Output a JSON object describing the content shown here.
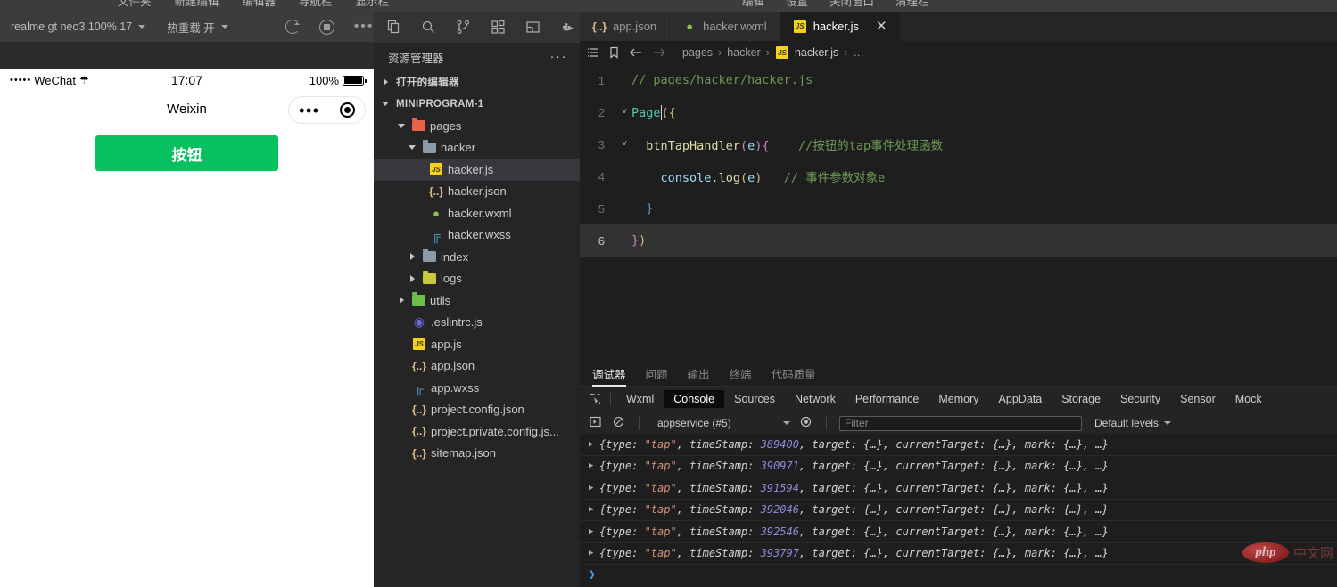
{
  "menubar": {
    "left_items": [
      "文件夹",
      "新建编辑",
      "编辑器",
      "导航栏",
      "显示栏"
    ],
    "right_items": [
      "编辑",
      "设置",
      "关闭窗口",
      "清理栏"
    ]
  },
  "simulator": {
    "device_selector": "realme gt neo3 100% 17",
    "hot_reload_label": "热重载 开",
    "icons": [
      "refresh-icon",
      "stop-icon",
      "more-icon"
    ],
    "phone": {
      "status_carrier": "WeChat",
      "status_dots": "•••••",
      "wifi_icon": "wifi-icon",
      "time": "17:07",
      "battery_percent": "100%",
      "nav_title": "Weixin",
      "capsule_more": "•••",
      "capsule_target": "target-icon",
      "button_label": "按钮",
      "button_color": "#07c160"
    }
  },
  "sidebar": {
    "activity_icons": [
      "files-icon",
      "search-icon",
      "source-control-icon",
      "extensions-icon",
      "layout-icon",
      "docker-icon"
    ],
    "title": "资源管理器",
    "more": "···",
    "sections": [
      {
        "label": "打开的编辑器",
        "expanded": false
      },
      {
        "label": "MINIPROGRAM-1",
        "expanded": true
      }
    ],
    "tree": [
      {
        "label": "pages",
        "type": "folder",
        "icon": "folder-pages-icon",
        "depth": 1,
        "expanded": true,
        "selected": false
      },
      {
        "label": "hacker",
        "type": "folder",
        "icon": "folder-icon",
        "depth": 2,
        "expanded": true,
        "selected": false
      },
      {
        "label": "hacker.js",
        "type": "js",
        "icon": "js-file-icon",
        "depth": 3,
        "selected": true
      },
      {
        "label": "hacker.json",
        "type": "json",
        "icon": "json-file-icon",
        "depth": 3,
        "selected": false
      },
      {
        "label": "hacker.wxml",
        "type": "wxml",
        "icon": "wxml-file-icon",
        "depth": 3,
        "selected": false
      },
      {
        "label": "hacker.wxss",
        "type": "wxss",
        "icon": "wxss-file-icon",
        "depth": 3,
        "selected": false
      },
      {
        "label": "index",
        "type": "folder",
        "icon": "folder-icon",
        "depth": 2,
        "expanded": false,
        "selected": false
      },
      {
        "label": "logs",
        "type": "folder",
        "icon": "folder-logs-icon",
        "depth": 2,
        "expanded": false,
        "selected": false
      },
      {
        "label": "utils",
        "type": "folder",
        "icon": "folder-utils-icon",
        "depth": 1,
        "expanded": false,
        "selected": false
      },
      {
        "label": ".eslintrc.js",
        "type": "eslint",
        "icon": "eslint-file-icon",
        "depth": 2,
        "selected": false
      },
      {
        "label": "app.js",
        "type": "js",
        "icon": "js-file-icon",
        "depth": 2,
        "selected": false
      },
      {
        "label": "app.json",
        "type": "json",
        "icon": "json-file-icon",
        "depth": 2,
        "selected": false
      },
      {
        "label": "app.wxss",
        "type": "wxss",
        "icon": "wxss-file-icon",
        "depth": 2,
        "selected": false
      },
      {
        "label": "project.config.json",
        "type": "json",
        "icon": "json-file-icon",
        "depth": 2,
        "selected": false
      },
      {
        "label": "project.private.config.js...",
        "type": "json",
        "icon": "json-file-icon",
        "depth": 2,
        "selected": false
      },
      {
        "label": "sitemap.json",
        "type": "json",
        "icon": "json-file-icon",
        "depth": 2,
        "selected": false
      }
    ]
  },
  "editor": {
    "tabs": [
      {
        "label": "app.json",
        "icon": "json-file-icon",
        "active": false,
        "closable": false
      },
      {
        "label": "hacker.wxml",
        "icon": "wxml-file-icon",
        "active": false,
        "closable": false
      },
      {
        "label": "hacker.js",
        "icon": "js-file-icon",
        "active": true,
        "closable": true
      }
    ],
    "close_icon": "✕",
    "breadcrumb_icons": [
      "outline-icon",
      "bookmark-icon",
      "back-arrow-icon",
      "forward-arrow-icon"
    ],
    "breadcrumb": [
      "pages",
      "hacker",
      "hacker.js",
      "…"
    ],
    "lines": [
      {
        "num": "1",
        "fold": "",
        "active": false
      },
      {
        "num": "2",
        "fold": "chevron-down",
        "active": false
      },
      {
        "num": "3",
        "fold": "chevron-down",
        "active": false
      },
      {
        "num": "4",
        "fold": "",
        "active": false
      },
      {
        "num": "5",
        "fold": "",
        "active": false
      },
      {
        "num": "6",
        "fold": "",
        "active": true
      }
    ],
    "code": {
      "l1_comment": "// pages/hacker/hacker.js",
      "l2_page": "Page",
      "l2_paren": "({",
      "l3_fn": "btnTapHandler",
      "l3_open": "(",
      "l3_arg": "e",
      "l3_close": "){",
      "l3_comment": "//按钮的tap事件处理函数",
      "l4_console": "console",
      "l4_dot": ".",
      "l4_log": "log",
      "l4_open": "(",
      "l4_arg": "e",
      "l4_close": ")",
      "l4_comment": "// 事件参数对象e",
      "l5_brace": "}",
      "l6_brace": "}",
      "l6_paren": ")"
    }
  },
  "panel": {
    "tabs": [
      {
        "label": "调试器",
        "active": true
      },
      {
        "label": "问题",
        "active": false
      },
      {
        "label": "输出",
        "active": false
      },
      {
        "label": "终端",
        "active": false
      },
      {
        "label": "代码质量",
        "active": false
      }
    ],
    "devtools_tabs": [
      {
        "label": "Wxml",
        "active": false
      },
      {
        "label": "Console",
        "active": true
      },
      {
        "label": "Sources",
        "active": false
      },
      {
        "label": "Network",
        "active": false
      },
      {
        "label": "Performance",
        "active": false
      },
      {
        "label": "Memory",
        "active": false
      },
      {
        "label": "AppData",
        "active": false
      },
      {
        "label": "Storage",
        "active": false
      },
      {
        "label": "Security",
        "active": false
      },
      {
        "label": "Sensor",
        "active": false
      },
      {
        "label": "Mock",
        "active": false
      }
    ],
    "inspect_icon": "inspect-element-icon",
    "console_toolbar": {
      "execute_icon": "execute-icon",
      "clear_icon": "clear-console-icon",
      "context": "appservice (#5)",
      "eye_icon": "live-expression-icon",
      "filter_placeholder": "Filter",
      "filter_value": "",
      "levels": "Default levels"
    },
    "console_logs": [
      {
        "prefix": "{type: ",
        "str": "\"tap\"",
        "mid": ", timeStamp: ",
        "num": "389400",
        "suffix": ", target: {…}, currentTarget: {…}, mark: {…}, …}"
      },
      {
        "prefix": "{type: ",
        "str": "\"tap\"",
        "mid": ", timeStamp: ",
        "num": "390971",
        "suffix": ", target: {…}, currentTarget: {…}, mark: {…}, …}"
      },
      {
        "prefix": "{type: ",
        "str": "\"tap\"",
        "mid": ", timeStamp: ",
        "num": "391594",
        "suffix": ", target: {…}, currentTarget: {…}, mark: {…}, …}"
      },
      {
        "prefix": "{type: ",
        "str": "\"tap\"",
        "mid": ", timeStamp: ",
        "num": "392046",
        "suffix": ", target: {…}, currentTarget: {…}, mark: {…}, …}"
      },
      {
        "prefix": "{type: ",
        "str": "\"tap\"",
        "mid": ", timeStamp: ",
        "num": "392546",
        "suffix": ", target: {…}, currentTarget: {…}, mark: {…}, …}"
      },
      {
        "prefix": "{type: ",
        "str": "\"tap\"",
        "mid": ", timeStamp: ",
        "num": "393797",
        "suffix": ", target: {…}, currentTarget: {…}, mark: {…}, …}"
      }
    ],
    "prompt": "❯"
  },
  "watermark": {
    "logo": "php",
    "text": "中文网"
  }
}
